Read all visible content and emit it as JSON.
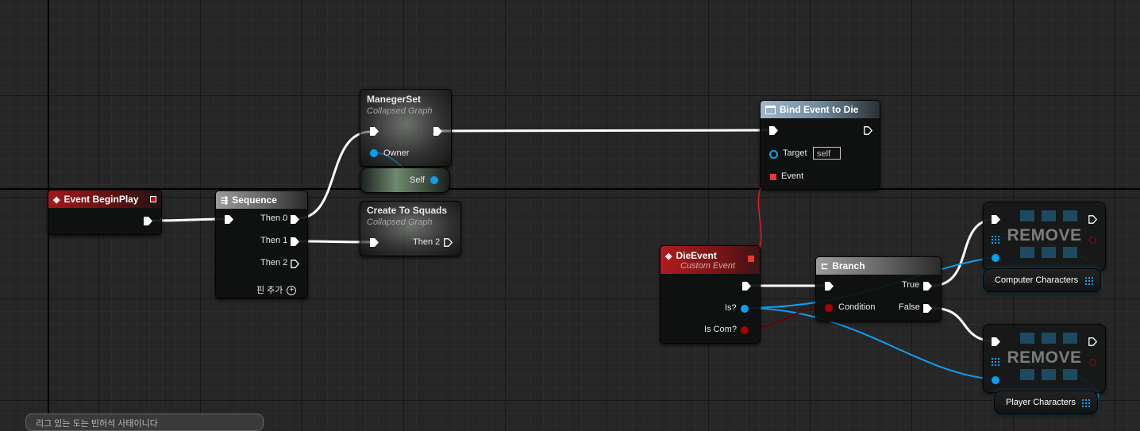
{
  "graph": {
    "event_begin_play": {
      "title": "Event BeginPlay"
    },
    "sequence": {
      "title": "Sequence",
      "outputs": [
        "Then 0",
        "Then 1",
        "Then 2"
      ],
      "add_pin_label": "핀 추가"
    },
    "maneger_set": {
      "title": "ManegerSet",
      "subtitle": "Collapsed Graph",
      "owner_label": "Owner",
      "self_label": "Self"
    },
    "create_to_squads": {
      "title": "Create To Squads",
      "subtitle": "Collapsed Graph",
      "output_label": "Then 2"
    },
    "bind_event": {
      "title": "Bind Event to Die",
      "target_label": "Target",
      "target_value": "self",
      "event_label": "Event"
    },
    "die_event": {
      "title": "DieEvent",
      "subtitle": "Custom Event",
      "pins": [
        "Is?",
        "Is Com?"
      ]
    },
    "branch": {
      "title": "Branch",
      "condition_label": "Condition",
      "true_label": "True",
      "false_label": "False"
    },
    "remove_nodes": [
      {
        "label": "REMOVE",
        "variable": "Computer Characters"
      },
      {
        "label": "REMOVE",
        "variable": "Player Characters"
      }
    ],
    "notification": {
      "text": "리그 있는 도는 빈허석 사태이니다"
    }
  },
  "colors": {
    "exec_wire": "#ffffff",
    "object_wire": "#0aa0ee",
    "bool_wire": "#8b0000",
    "delegate_wire": "#d92020"
  }
}
